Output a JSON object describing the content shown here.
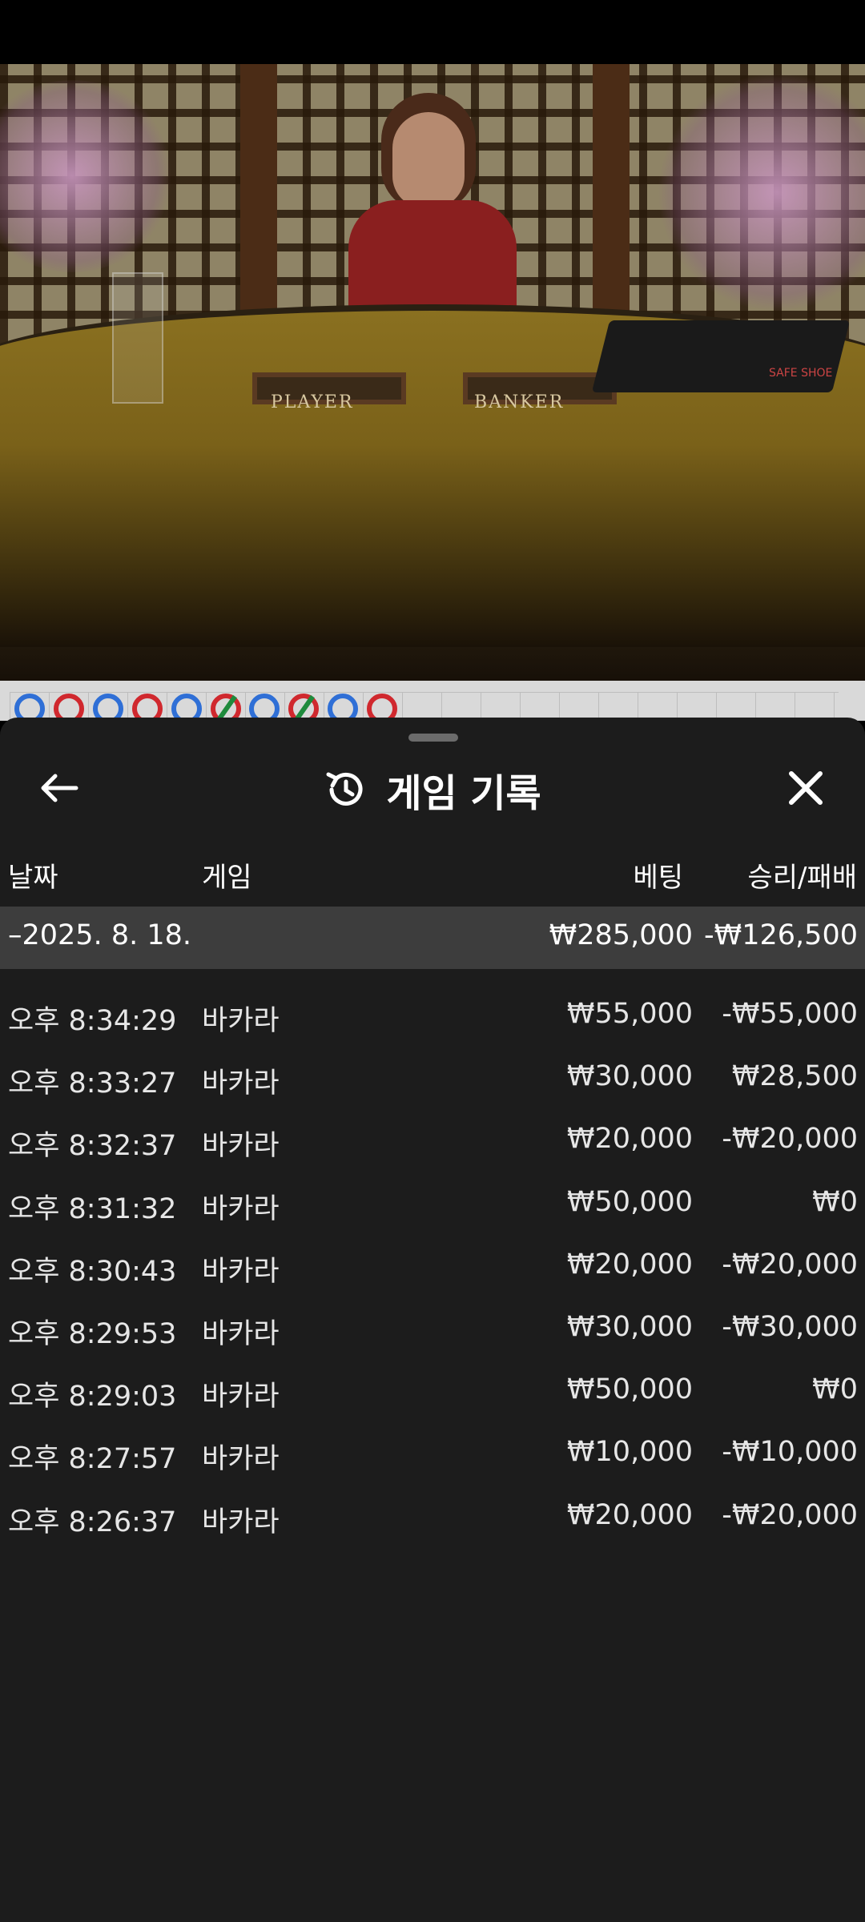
{
  "header": {
    "title": "게임 기록"
  },
  "columns": {
    "date": "날짜",
    "game": "게임",
    "bet": "베팅",
    "result": "승리/패배"
  },
  "table_labels": {
    "player": "PLAYER",
    "banker": "BANKER",
    "shoe": "SAFE SHOE"
  },
  "date_group": {
    "date": "–2025. 8. 18.",
    "bet_total": "₩285,000",
    "result_total": "-₩126,500"
  },
  "rows": [
    {
      "time": "오후 8:34:29",
      "game": "바카라",
      "bet": "₩55,000",
      "result": "-₩55,000"
    },
    {
      "time": "오후 8:33:27",
      "game": "바카라",
      "bet": "₩30,000",
      "result": "₩28,500"
    },
    {
      "time": "오후 8:32:37",
      "game": "바카라",
      "bet": "₩20,000",
      "result": "-₩20,000"
    },
    {
      "time": "오후 8:31:32",
      "game": "바카라",
      "bet": "₩50,000",
      "result": "₩0"
    },
    {
      "time": "오후 8:30:43",
      "game": "바카라",
      "bet": "₩20,000",
      "result": "-₩20,000"
    },
    {
      "time": "오후 8:29:53",
      "game": "바카라",
      "bet": "₩30,000",
      "result": "-₩30,000"
    },
    {
      "time": "오후 8:29:03",
      "game": "바카라",
      "bet": "₩50,000",
      "result": "₩0"
    },
    {
      "time": "오후 8:27:57",
      "game": "바카라",
      "bet": "₩10,000",
      "result": "-₩10,000"
    },
    {
      "time": "오후 8:26:37",
      "game": "바카라",
      "bet": "₩20,000",
      "result": "-₩20,000"
    }
  ],
  "roadmap": {
    "beads": [
      "player",
      "banker",
      "player",
      "banker",
      "player",
      "banker-tie",
      "player",
      "banker-tie",
      "player",
      "banker"
    ]
  },
  "colors": {
    "player": "#2f6fd6",
    "banker": "#d0282e",
    "tie": "#1e8a3c",
    "sheet": "#1c1c1c",
    "date_row": "#3d3d3d"
  },
  "icons": {
    "back": "arrow-left-icon",
    "history": "history-icon",
    "close": "close-icon"
  }
}
